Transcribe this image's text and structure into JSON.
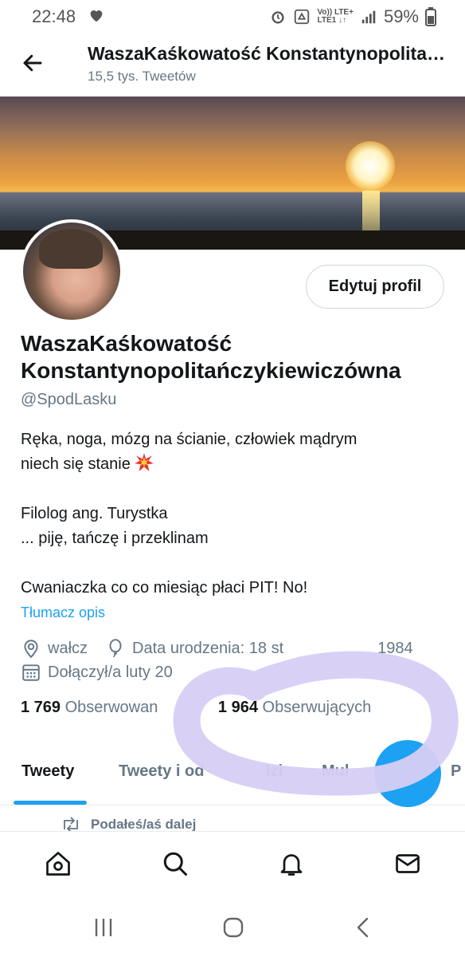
{
  "status_bar": {
    "time": "22:48",
    "network_line1": "Vo)) LTE+",
    "network_line2": "LTE1 ↓↑",
    "battery": "59%"
  },
  "header": {
    "title": "WaszaKaśkowatość Konstantynopolitańczykiewiczówna",
    "tweet_count": "15,5 tys. Tweetów"
  },
  "profile": {
    "edit_button": "Edytuj profil",
    "display_name": "WaszaKaśkowatość Konstantynopolitańczykiewiczówna",
    "handle": "@SpodLasku",
    "bio_lines": [
      "Ręka, noga, mózg na ścianie, człowiek mądrym",
      "niech się stanie",
      "",
      "Filolog ang. Turystka",
      "... piję, tańczę i przeklinam",
      "",
      "Cwaniaczka co co miesiąc płaci PIT! No!"
    ],
    "translate_link": "Tłumacz opis",
    "location": "wałcz",
    "birthday": "Data urodzenia: 18 st",
    "birthday_end": "1984",
    "joined": "Dołączył/a luty 20",
    "following_count": "1 769",
    "following_label": "Obserwowan",
    "followers_count": "1 964",
    "followers_label": "Obserwujących"
  },
  "tabs": [
    {
      "label": "Tweety",
      "active": true
    },
    {
      "label": "Tweety i od",
      "active": false
    },
    {
      "label": "lzi",
      "active": false
    },
    {
      "label": "Mul",
      "active": false
    },
    {
      "label": "P",
      "active": false
    }
  ],
  "feed": {
    "retweet_label": "Podałeś/aś dalej"
  },
  "colors": {
    "accent": "#1da1f2",
    "secondary_text": "#657786",
    "highlight": "#dcd6f5"
  }
}
